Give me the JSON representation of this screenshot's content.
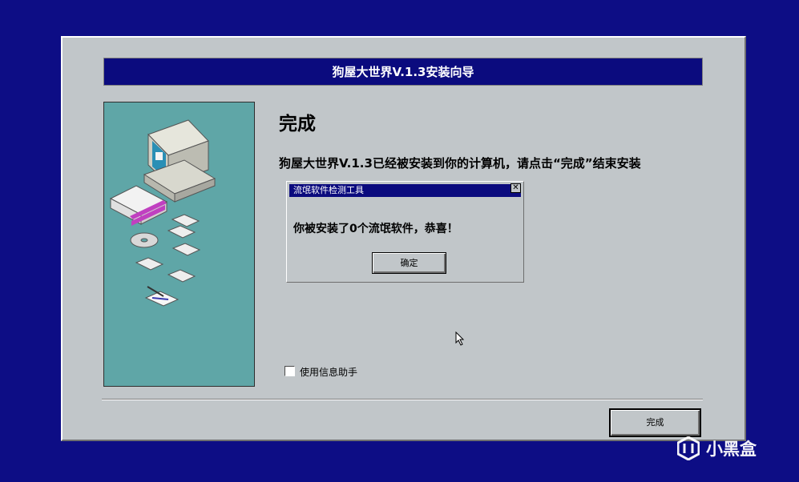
{
  "window": {
    "title": "狗屋大世界V.1.3安装向导"
  },
  "main": {
    "heading": "完成",
    "message": "狗屋大世界V.1.3已经被安装到你的计算机，请点击“完成”结束安装"
  },
  "dialog": {
    "title": "流氓软件检测工具",
    "message": "你被安装了0个流氓软件，恭喜！",
    "ok_label": "确定",
    "close_glyph": "✕"
  },
  "assistant": {
    "label": "使用信息助手",
    "checked": false
  },
  "footer": {
    "finish_label": "完成"
  },
  "watermark": {
    "text": "小黑盒"
  },
  "colors": {
    "desktop": "#0d0d85",
    "titlebar": "#0b0b7e",
    "panel": "#c1c6c9",
    "art_bg": "#5fa6a7"
  }
}
